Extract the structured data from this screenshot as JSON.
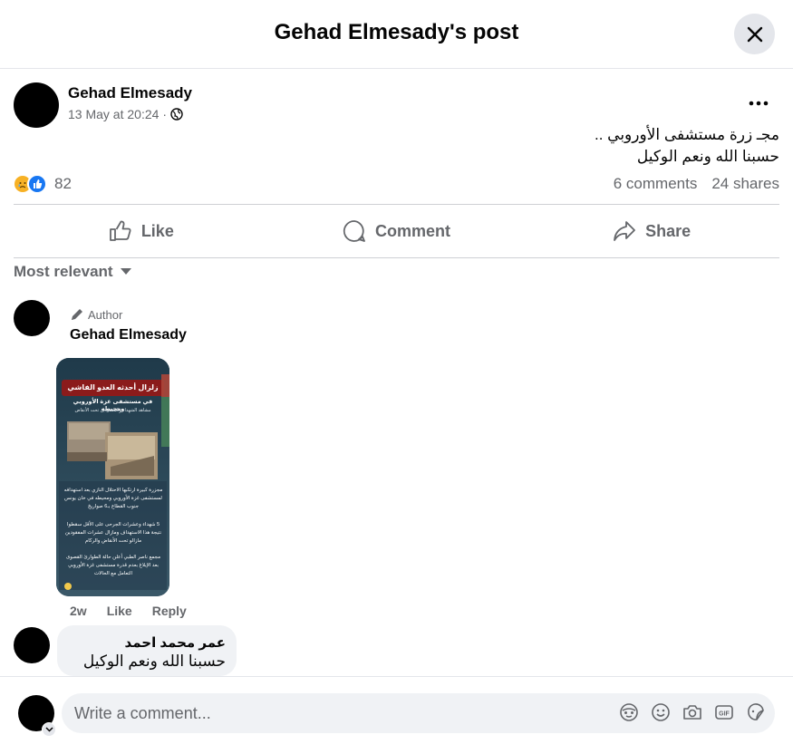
{
  "header": {
    "title": "Gehad Elmesady's post",
    "close_icon": "close-icon"
  },
  "post": {
    "author": "Gehad Elmesady",
    "time": "13 May at 20:24",
    "separator": "·",
    "privacy_icon": "globe-icon",
    "text_lines": [
      "مجـ زرة مستشفى الأوروبي ..",
      "حسبنا الله ونعم الوكيل"
    ],
    "reaction_icons": [
      "sad-reaction-icon",
      "like-reaction-icon"
    ],
    "reaction_count": "82",
    "comments_count": "6 comments",
    "shares_count": "24 shares"
  },
  "actions": {
    "like": "Like",
    "comment": "Comment",
    "share": "Share"
  },
  "sort": {
    "label": "Most relevant"
  },
  "comments": [
    {
      "badge": "Author",
      "name": "Gehad Elmesady",
      "time": "2w",
      "like": "Like",
      "reply": "Reply",
      "image": {
        "headline": "زلزال أحدثه العدو الفاشي",
        "subhead": "في مستشفى غزة الأوروبي ومحيطه",
        "subhead2": "مشاهد الشهداء والمفقودين تحت الأنقاض",
        "para1": "مجزرة كبيرة ارتكبها الاحتلال النازي بعد استهدافه لمستشفى غزة الأوروبي ومحيطه في خان يونس جنوب القطاع بـ6 صواريخ",
        "para2": "5 شهداء وعشرات الجرحى على الأقل سقطوا نتيجة هذا الاستهداف ومازال عشرات المفقودين مازالو تحت الأنقاض والركام",
        "para3": "مجمع ناصر الطبي أعلن حالة الطوارئ القصوى بعد الإبلاغ بعدم قدرة مستشفى غزة الأوروبي التعامل مع الحالات"
      }
    },
    {
      "name": "عمر محمد احمد",
      "text": "حسبنا الله ونعم الوكيل"
    }
  ],
  "composer": {
    "placeholder": "Write a comment...",
    "tools": [
      "avatar-sticker-icon",
      "emoji-icon",
      "camera-icon",
      "gif-icon",
      "sticker-icon"
    ]
  },
  "colors": {
    "accent": "#1877f2",
    "secondary_text": "#65676b",
    "bubble_bg": "#f0f2f5"
  }
}
